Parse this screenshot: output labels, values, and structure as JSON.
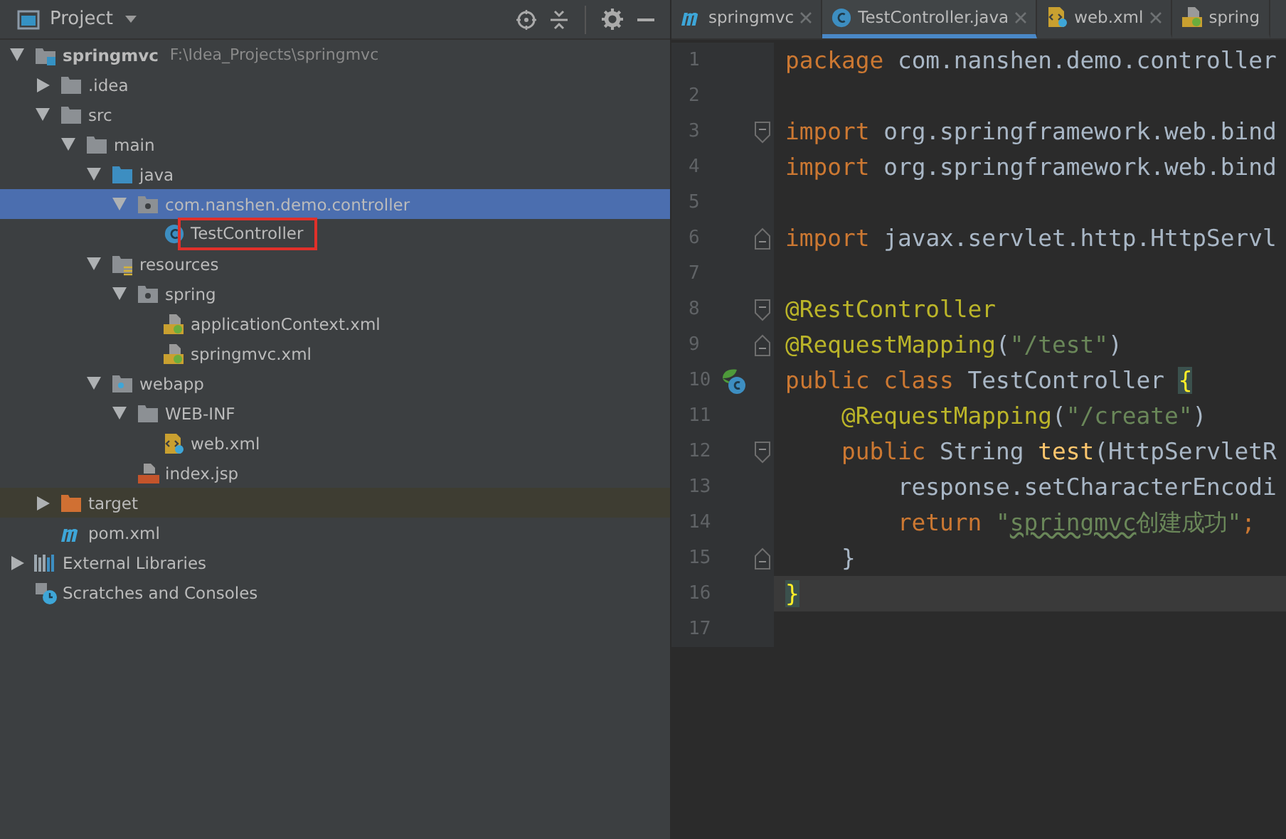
{
  "project_panel": {
    "title": "Project",
    "tree": [
      {
        "label": "springmvc",
        "hint": "F:\\Idea_Projects\\springmvc",
        "kind": "module",
        "bold": true,
        "expanded": true,
        "selected": false,
        "children": [
          {
            "label": ".idea",
            "kind": "folder",
            "expanded": false,
            "selected": false
          },
          {
            "label": "src",
            "kind": "folder",
            "expanded": true,
            "selected": false,
            "children": [
              {
                "label": "main",
                "kind": "folder",
                "expanded": true,
                "selected": false,
                "children": [
                  {
                    "label": "java",
                    "kind": "source-folder",
                    "expanded": true,
                    "selected": false,
                    "children": [
                      {
                        "label": "com.nanshen.demo.controller",
                        "kind": "package",
                        "expanded": true,
                        "selected": true,
                        "children": [
                          {
                            "label": "TestController",
                            "kind": "class",
                            "selected": false,
                            "boxed": true
                          }
                        ]
                      }
                    ]
                  },
                  {
                    "label": "resources",
                    "kind": "resource-folder",
                    "expanded": true,
                    "selected": false,
                    "children": [
                      {
                        "label": "spring",
                        "kind": "package",
                        "expanded": true,
                        "selected": false,
                        "children": [
                          {
                            "label": "applicationContext.xml",
                            "kind": "spring-xml",
                            "selected": false
                          },
                          {
                            "label": "springmvc.xml",
                            "kind": "spring-xml",
                            "selected": false
                          }
                        ]
                      }
                    ]
                  },
                  {
                    "label": "webapp",
                    "kind": "web-folder",
                    "expanded": true,
                    "selected": false,
                    "children": [
                      {
                        "label": "WEB-INF",
                        "kind": "folder",
                        "expanded": true,
                        "selected": false,
                        "children": [
                          {
                            "label": "web.xml",
                            "kind": "web-xml",
                            "selected": false
                          }
                        ]
                      },
                      {
                        "label": "index.jsp",
                        "kind": "jsp",
                        "selected": false
                      }
                    ]
                  }
                ]
              }
            ]
          },
          {
            "label": "target",
            "kind": "excluded-folder",
            "expanded": false,
            "selected": false,
            "excluded": true
          },
          {
            "label": "pom.xml",
            "kind": "maven",
            "selected": false
          }
        ]
      },
      {
        "label": "External Libraries",
        "kind": "libraries",
        "expanded": false,
        "selected": false
      },
      {
        "label": "Scratches and Consoles",
        "kind": "scratches",
        "selected": false
      }
    ]
  },
  "editor": {
    "tabs": [
      {
        "label": "springmvc",
        "kind": "maven",
        "selected": false
      },
      {
        "label": "TestController.java",
        "kind": "class",
        "selected": true
      },
      {
        "label": "web.xml",
        "kind": "web-xml",
        "selected": false
      },
      {
        "label": "spring",
        "kind": "spring-xml",
        "selected": false
      }
    ],
    "lines": [
      {
        "number": "1",
        "tokens": [
          {
            "kind": "keyword",
            "text": "package"
          },
          {
            "kind": "plain",
            "text": " com.nanshen.demo.controller"
          }
        ]
      },
      {
        "number": "2"
      },
      {
        "number": "3",
        "fold_start": true,
        "tokens": [
          {
            "kind": "keyword",
            "text": "import"
          },
          {
            "kind": "plain",
            "text": " org.springframework.web.bind"
          }
        ]
      },
      {
        "number": "4",
        "tokens": [
          {
            "kind": "keyword",
            "text": "import"
          },
          {
            "kind": "plain",
            "text": " org.springframework.web.bind"
          }
        ]
      },
      {
        "number": "5"
      },
      {
        "number": "6",
        "fold_end": true,
        "tokens": [
          {
            "kind": "keyword",
            "text": "import"
          },
          {
            "kind": "plain",
            "text": " javax.servlet.http.HttpServl"
          }
        ]
      },
      {
        "number": "7"
      },
      {
        "number": "8",
        "fold_start": true,
        "tokens": [
          {
            "kind": "annotation",
            "text": "@RestController"
          }
        ]
      },
      {
        "number": "9",
        "fold_end": true,
        "tokens": [
          {
            "kind": "annotation",
            "text": "@RequestMapping"
          },
          {
            "kind": "plain",
            "text": "("
          },
          {
            "kind": "string",
            "text": "\"/test\""
          },
          {
            "kind": "plain",
            "text": ")"
          }
        ]
      },
      {
        "number": "10",
        "class_marker": true,
        "tokens": [
          {
            "kind": "keyword",
            "text": "public class"
          },
          {
            "kind": "plain",
            "text": " TestController "
          },
          {
            "kind": "brace-match",
            "text": "{"
          }
        ]
      },
      {
        "number": "11",
        "tokens": [
          {
            "kind": "annotation",
            "text": "    @RequestMapping"
          },
          {
            "kind": "plain",
            "text": "("
          },
          {
            "kind": "string",
            "text": "\"/create\""
          },
          {
            "kind": "plain",
            "text": ")"
          }
        ]
      },
      {
        "number": "12",
        "fold_start": true,
        "tokens": [
          {
            "kind": "keyword",
            "text": "    public"
          },
          {
            "kind": "plain",
            "text": " String "
          },
          {
            "kind": "method",
            "text": "test"
          },
          {
            "kind": "plain",
            "text": "(HttpServletR"
          }
        ]
      },
      {
        "number": "13",
        "tokens": [
          {
            "kind": "plain",
            "text": "        response.setCharacterEncodi"
          }
        ]
      },
      {
        "number": "14",
        "tokens": [
          {
            "kind": "keyword",
            "text": "        return"
          },
          {
            "kind": "string",
            "text": " \""
          },
          {
            "kind": "string-typo",
            "text": "springmvc"
          },
          {
            "kind": "string",
            "text": "创建成功\""
          },
          {
            "kind": "keyword",
            "text": ";"
          }
        ]
      },
      {
        "number": "15",
        "fold_end": true,
        "tokens": [
          {
            "kind": "plain",
            "text": "    }"
          }
        ]
      },
      {
        "number": "16",
        "current": true,
        "tokens": [
          {
            "kind": "brace-match",
            "text": "}"
          }
        ]
      },
      {
        "number": "17"
      }
    ]
  }
}
